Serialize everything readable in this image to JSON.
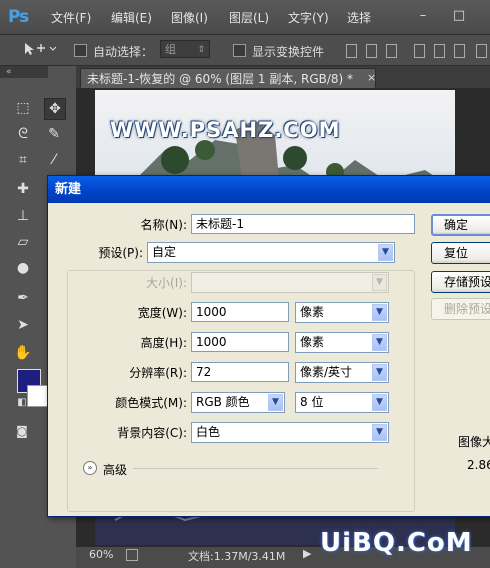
{
  "app": {
    "logo": "Ps"
  },
  "menu": {
    "items": [
      "文件(F)",
      "编辑(E)",
      "图像(I)",
      "图层(L)",
      "文字(Y)",
      "选择"
    ],
    "minimize": "–",
    "maximize": "□"
  },
  "options_bar": {
    "auto_select_label": "自动选择：",
    "auto_select_value": "组",
    "show_transform_label": "显示变换控件"
  },
  "document": {
    "tab_title": "未标题-1-恢复的 @ 60% (图层 1 副本, RGB/8) *",
    "tab_close": "×",
    "watermark": "WWW.PSAHZ.COM",
    "zoom": "60%",
    "doc_size": "文档:1.37M/3.41M",
    "site_watermark": "UiBQ.CoM"
  },
  "colors": {
    "foreground": "#1e1e80",
    "background": "#ffffff",
    "dialog_title": "#0042c8"
  },
  "dialog": {
    "title": "新建",
    "name_label": "名称(N):",
    "name_value": "未标题-1",
    "preset_label": "预设(P):",
    "preset_value": "自定",
    "size_label": "大小(I):",
    "size_value": "",
    "width_label": "宽度(W):",
    "width_value": "1000",
    "width_unit": "像素",
    "height_label": "高度(H):",
    "height_value": "1000",
    "height_unit": "像素",
    "resolution_label": "分辨率(R):",
    "resolution_value": "72",
    "resolution_unit": "像素/英寸",
    "color_mode_label": "颜色模式(M):",
    "color_mode_value": "RGB 颜色",
    "bit_depth_value": "8 位",
    "background_label": "背景内容(C):",
    "background_value": "白色",
    "advanced_label": "高级",
    "image_size_label": "图像大",
    "image_size_value": "2.86",
    "buttons": {
      "ok": "确定",
      "reset": "复位",
      "save_preset": "存储预设",
      "delete_preset": "删除预设"
    }
  }
}
